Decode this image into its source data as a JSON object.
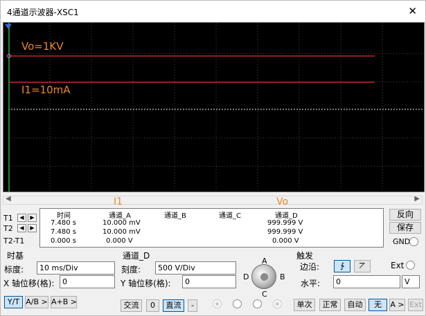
{
  "window": {
    "title": "4通道示波器-XSC1",
    "close_glyph": "✕"
  },
  "screen": {
    "trace_labels": [
      "Vo=1KV",
      "I1=10mA"
    ],
    "colors": {
      "background": "#000000",
      "grid": "#4a4a4a",
      "trace": "#e0303a",
      "label": "#e8872c",
      "center": "#dcdcdc",
      "axis": "#2fae3a"
    }
  },
  "cursor_labels": [
    "I1",
    "Vo"
  ],
  "readout": {
    "headers": [
      "时间",
      "通道_A",
      "通道_B",
      "通道_C",
      "通道_D"
    ],
    "rows": [
      {
        "label": "T1",
        "time": "7.480 s",
        "a": "10.000 mV",
        "b": "",
        "c": "",
        "d": "999.999 V"
      },
      {
        "label": "T2",
        "time": "7.480 s",
        "a": "10.000 mV",
        "b": "",
        "c": "",
        "d": "999.999 V"
      },
      {
        "label": "T2-T1",
        "time": "0.000 s",
        "a": "0.000 V",
        "b": "",
        "c": "",
        "d": "0.000 V"
      }
    ],
    "reverse_label": "反向",
    "save_label": "保存",
    "gnd_label": "GND"
  },
  "timebase": {
    "title": "时基",
    "scale_label": "标度:",
    "scale_value": "10 ms/Div",
    "xpos_label": "X 轴位移(格):",
    "xpos_value": "0",
    "modes": [
      "Y/T",
      "A/B >",
      "A+B >"
    ]
  },
  "channel": {
    "title": "通道_D",
    "scale_label": "刻度:",
    "scale_value": "500  V/Div",
    "ypos_label": "Y 轴位移(格):",
    "ypos_value": "0",
    "coupling": [
      "交流",
      "0",
      "直流",
      "-"
    ],
    "knob_labels": {
      "a": "A",
      "b": "B",
      "c": "C",
      "d": "D"
    }
  },
  "trigger": {
    "title": "触发",
    "edge_label": "边沿:",
    "edge_rise": "∱",
    "edge_fall": "⦢",
    "ext_label": "Ext",
    "level_label": "水平:",
    "level_value": "0",
    "level_unit": "V",
    "modes": [
      "单次",
      "正常",
      "自动",
      "无",
      "A >",
      "Ext"
    ]
  }
}
